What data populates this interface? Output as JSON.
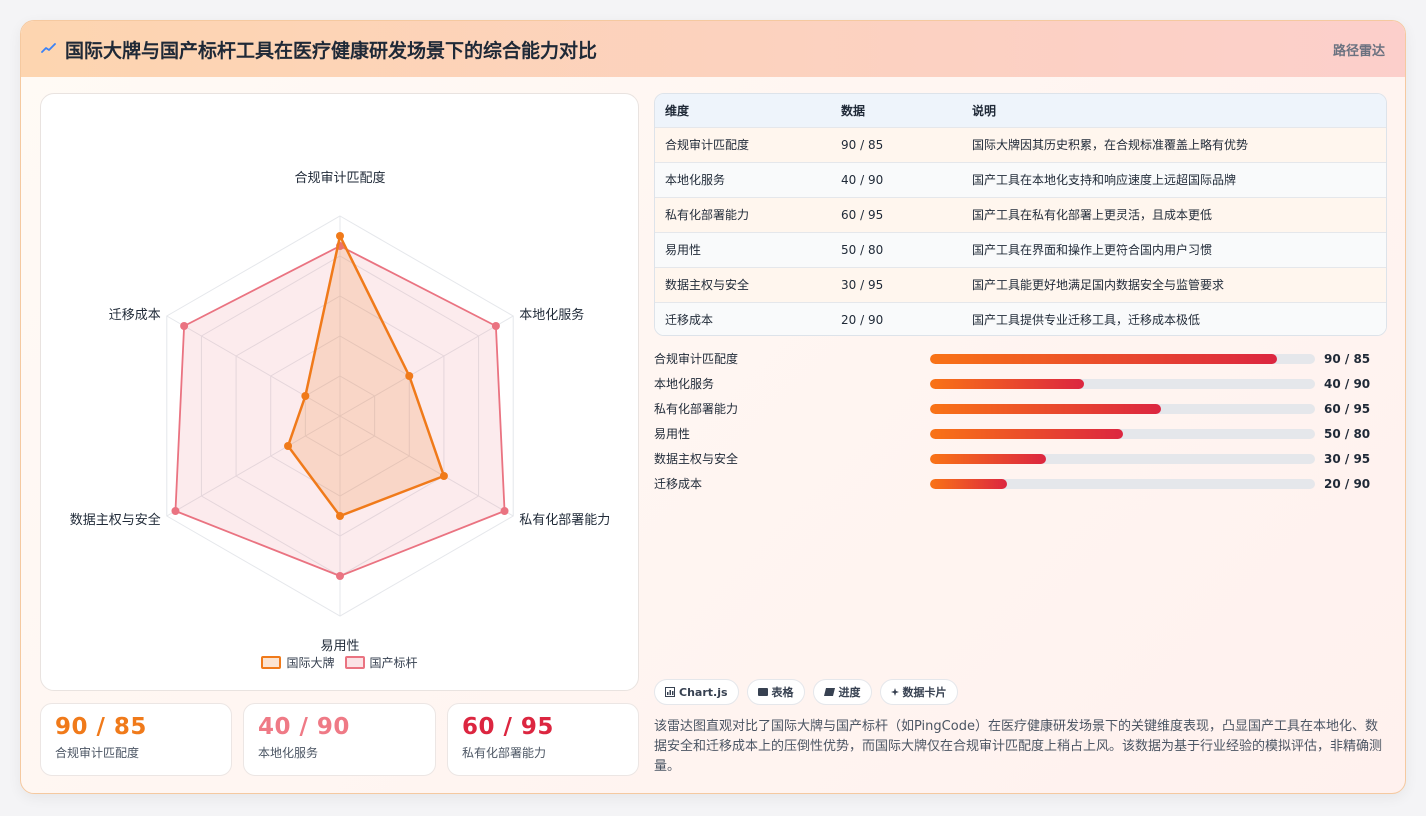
{
  "header": {
    "title": "国际大牌与国产标杆工具在医疗健康研发场景下的综合能力对比",
    "tag": "路径雷达"
  },
  "chart_data": {
    "type": "radar",
    "axes": [
      "合规审计匹配度",
      "本地化服务",
      "私有化部署能力",
      "易用性",
      "数据主权与安全",
      "迁移成本"
    ],
    "range": [
      0,
      100
    ],
    "series": [
      {
        "name": "国际大牌",
        "color": "#f07a1a",
        "values": [
          90,
          40,
          60,
          50,
          30,
          20
        ]
      },
      {
        "name": "国产标杆",
        "color": "#ea7381",
        "values": [
          85,
          90,
          95,
          80,
          95,
          90
        ]
      }
    ]
  },
  "stats": [
    {
      "value": "90 / 85",
      "label": "合规审计匹配度",
      "color": "#f07a1a"
    },
    {
      "value": "40 / 90",
      "label": "本地化服务",
      "color": "#ef7a86"
    },
    {
      "value": "60 / 95",
      "label": "私有化部署能力",
      "color": "#dc2640"
    }
  ],
  "table": {
    "headers": [
      "维度",
      "数据",
      "说明"
    ],
    "rows": [
      [
        "合规审计匹配度",
        "90 / 85",
        "国际大牌因其历史积累，在合规标准覆盖上略有优势"
      ],
      [
        "本地化服务",
        "40 / 90",
        "国产工具在本地化支持和响应速度上远超国际品牌"
      ],
      [
        "私有化部署能力",
        "60 / 95",
        "国产工具在私有化部署上更灵活，且成本更低"
      ],
      [
        "易用性",
        "50 / 80",
        "国产工具在界面和操作上更符合国内用户习惯"
      ],
      [
        "数据主权与安全",
        "30 / 95",
        "国产工具能更好地满足国内数据安全与监管要求"
      ],
      [
        "迁移成本",
        "20 / 90",
        "国产工具提供专业迁移工具，迁移成本极低"
      ]
    ]
  },
  "progress": [
    {
      "label": "合规审计匹配度",
      "value": "90 / 85",
      "fill": 0.9
    },
    {
      "label": "本地化服务",
      "value": "40 / 90",
      "fill": 0.4
    },
    {
      "label": "私有化部署能力",
      "value": "60 / 95",
      "fill": 0.6
    },
    {
      "label": "易用性",
      "value": "50 / 80",
      "fill": 0.5
    },
    {
      "label": "数据主权与安全",
      "value": "30 / 95",
      "fill": 0.3
    },
    {
      "label": "迁移成本",
      "value": "20 / 90",
      "fill": 0.2
    }
  ],
  "chips": [
    {
      "icon": "chart-icon",
      "label": "Chart.js"
    },
    {
      "icon": "table-icon",
      "label": "表格"
    },
    {
      "icon": "progress-icon",
      "label": "进度"
    },
    {
      "icon": "sparkle-icon",
      "label": "数据卡片"
    }
  ],
  "description": "该雷达图直观对比了国际大牌与国产标杆（如PingCode）在医疗健康研发场景下的关键维度表现，凸显国产工具在本地化、数据安全和迁移成本上的压倒性优势，而国际大牌仅在合规审计匹配度上稍占上风。该数据为基于行业经验的模拟评估，非精确测量。"
}
